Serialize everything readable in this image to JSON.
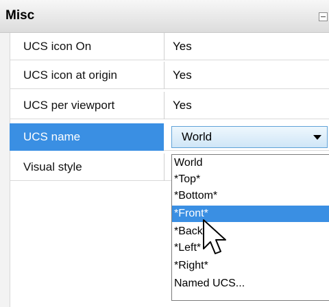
{
  "category": {
    "title": "Misc"
  },
  "properties": [
    {
      "name": "UCS icon On",
      "value": "Yes"
    },
    {
      "name": "UCS icon at origin",
      "value": "Yes"
    },
    {
      "name": "UCS per viewport",
      "value": "Yes"
    },
    {
      "name": "UCS name",
      "value": "World"
    },
    {
      "name": "Visual style",
      "value": ""
    }
  ],
  "dropdown": {
    "options": [
      "World",
      "*Top*",
      "*Bottom*",
      "*Front*",
      "*Back*",
      "*Left*",
      "*Right*",
      "Named UCS..."
    ],
    "highlighted": "*Front*"
  },
  "colors": {
    "selection": "#3a8fe3",
    "category_bg": "#dcdcdc"
  },
  "icons": {
    "collapse": "collapse-icon",
    "cursor": "arrow-cursor-icon"
  }
}
